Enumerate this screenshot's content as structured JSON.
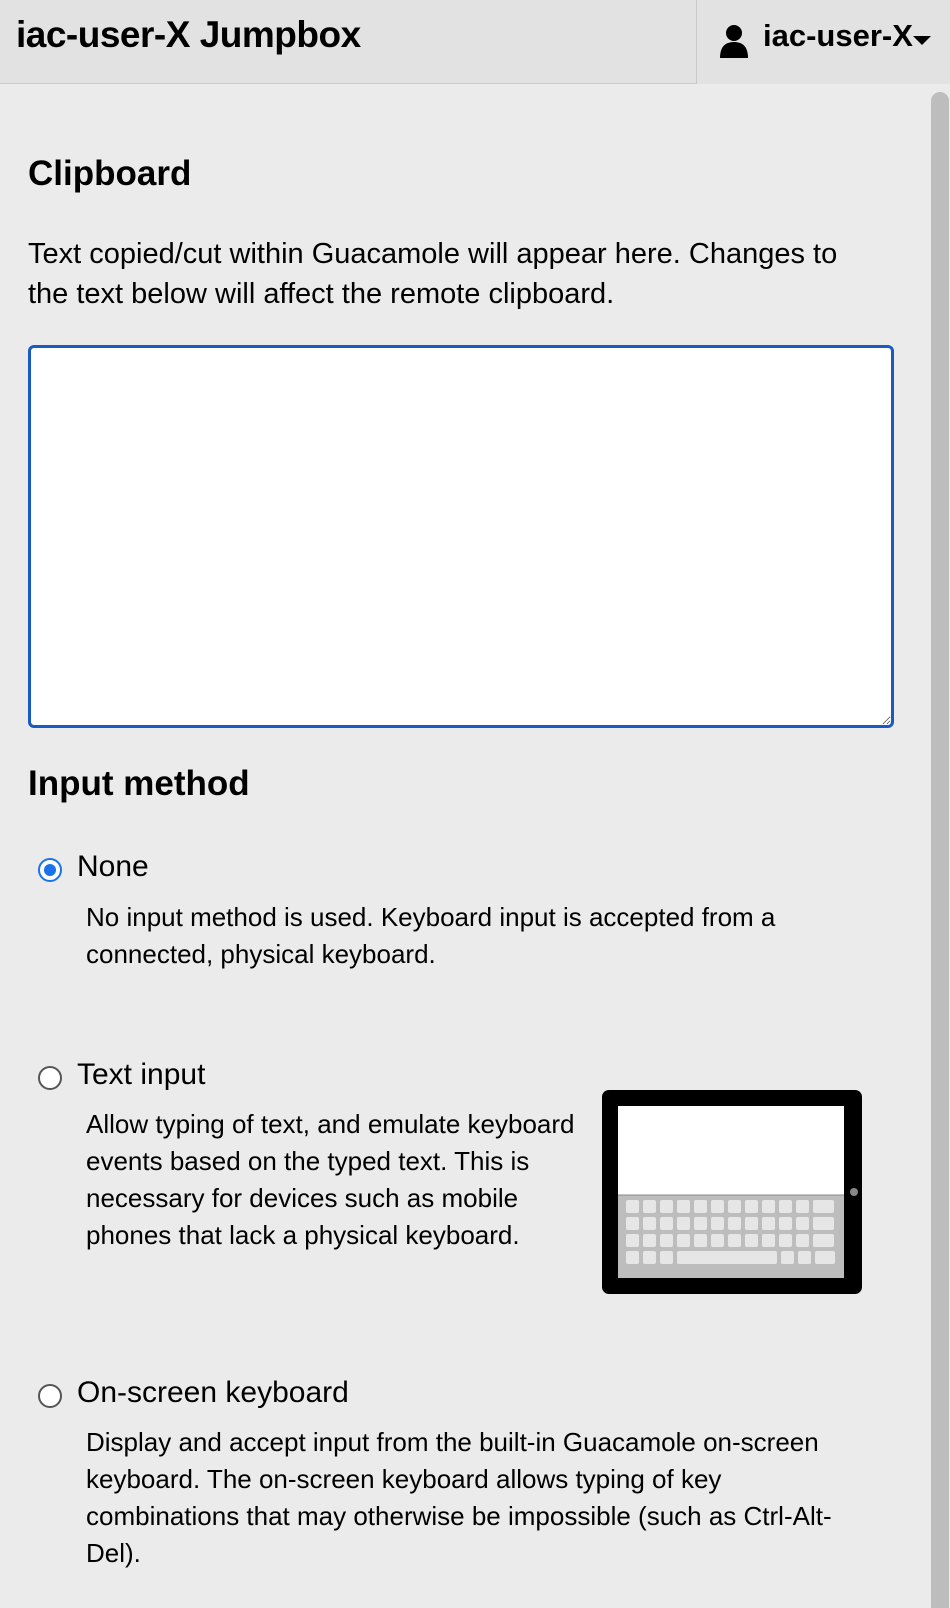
{
  "header": {
    "title": "iac-user-X Jumpbox",
    "user_menu": {
      "username": "iac-user-X",
      "icon": "user-icon"
    }
  },
  "clipboard": {
    "heading": "Clipboard",
    "description": "Text copied/cut within Guacamole will appear here. Changes to the text below will affect the remote clipboard.",
    "value": ""
  },
  "input_method": {
    "heading": "Input method",
    "selected": "None",
    "options": [
      {
        "label": "None",
        "description": "No input method is used. Keyboard input is accepted from a connected, physical keyboard."
      },
      {
        "label": "Text input",
        "description": "Allow typing of text, and emulate keyboard events based on the typed text. This is necessary for devices such as mobile phones that lack a physical keyboard."
      },
      {
        "label": "On-screen keyboard",
        "description": "Display and accept input from the built-in Guacamole on-screen keyboard. The on-screen keyboard allows typing of key combinations that may otherwise be impossible (such as Ctrl-Alt-Del)."
      }
    ]
  },
  "colors": {
    "accent": "#1a73e8",
    "textarea_border": "#1a5bc2",
    "background": "#ebebeb",
    "header": "#e2e2e2"
  }
}
